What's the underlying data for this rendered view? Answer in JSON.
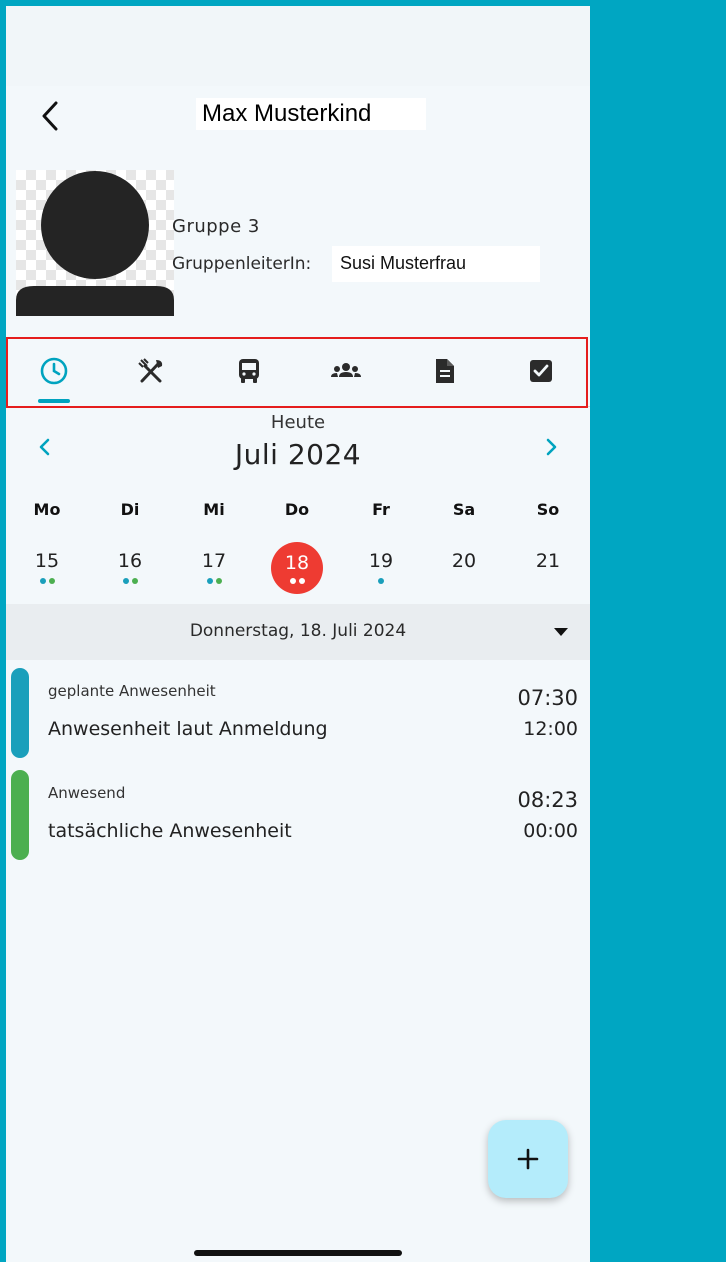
{
  "header": {
    "title": "Max Musterkind",
    "back_icon": "chevron-left-icon"
  },
  "profile": {
    "group": "Gruppe 3",
    "leader_label": "GruppenleiterIn:",
    "leader_name": "Susi Musterfrau",
    "avatar_icon": "person-silhouette-icon"
  },
  "tabs": [
    {
      "icon": "clock-icon",
      "active": true
    },
    {
      "icon": "fork-knife-icon",
      "active": false
    },
    {
      "icon": "bus-icon",
      "active": false
    },
    {
      "icon": "group-icon",
      "active": false
    },
    {
      "icon": "document-icon",
      "active": false
    },
    {
      "icon": "checkbox-icon",
      "active": false
    }
  ],
  "calendar": {
    "today_label": "Heute",
    "month_label": "Juli 2024",
    "weekdays": [
      "Mo",
      "Di",
      "Mi",
      "Do",
      "Fr",
      "Sa",
      "So"
    ],
    "days": [
      {
        "num": "15",
        "dots": [
          "#1a9fbb",
          "#4caf50"
        ],
        "selected": false
      },
      {
        "num": "16",
        "dots": [
          "#1a9fbb",
          "#4caf50"
        ],
        "selected": false
      },
      {
        "num": "17",
        "dots": [
          "#1a9fbb",
          "#4caf50"
        ],
        "selected": false
      },
      {
        "num": "18",
        "dots": [
          "#ffffff",
          "#ffffff"
        ],
        "selected": true
      },
      {
        "num": "19",
        "dots": [
          "#1a9fbb"
        ],
        "selected": false
      },
      {
        "num": "20",
        "dots": [],
        "selected": false
      },
      {
        "num": "21",
        "dots": [],
        "selected": false
      }
    ]
  },
  "selected_date": "Donnerstag, 18. Juli 2024",
  "entries": [
    {
      "label": "geplante Anwesenheit",
      "description": "Anwesenheit laut Anmeldung",
      "start": "07:30",
      "end": "12:00",
      "color": "#1a9fbb"
    },
    {
      "label": "Anwesend",
      "description": "tatsächliche Anwesenheit",
      "start": "08:23",
      "end": "00:00",
      "color": "#4caf50"
    }
  ],
  "colors": {
    "accent": "#00a3bf",
    "selected_day": "#ee3b32",
    "background_outer": "#00a6c2",
    "fab": "#b4ecfb",
    "highlight_box": "#e51d1d"
  },
  "fab_icon": "plus-icon"
}
